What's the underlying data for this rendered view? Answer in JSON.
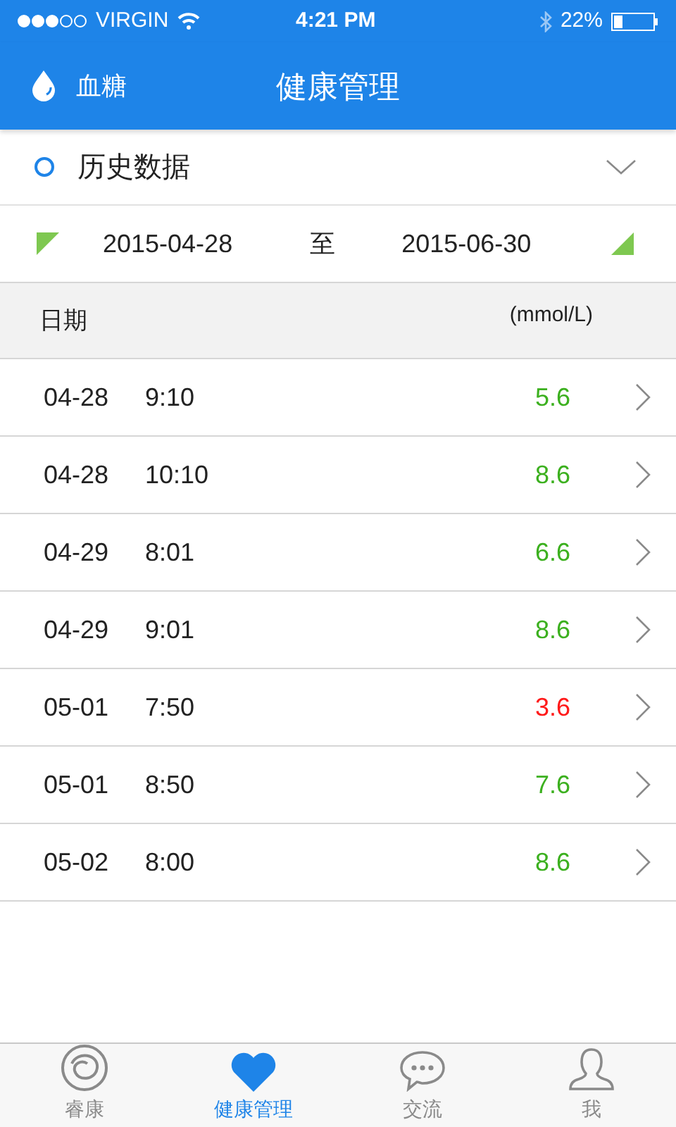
{
  "status_bar": {
    "carrier": "VIRGIN",
    "time": "4:21 PM",
    "battery": "22%"
  },
  "header": {
    "left_label": "血糖",
    "title": "健康管理"
  },
  "section": {
    "title": "历史数据",
    "expanded": false
  },
  "date_range": {
    "start": "2015-04-28",
    "separator": "至",
    "end": "2015-06-30"
  },
  "table": {
    "columns": [
      "日期",
      "(mmol/L)"
    ],
    "rows": [
      {
        "date": "04-28",
        "time": "9:10",
        "value": "5.6",
        "color": "#3cb01f"
      },
      {
        "date": "04-28",
        "time": "10:10",
        "value": "8.6",
        "color": "#3cb01f"
      },
      {
        "date": "04-29",
        "time": "8:01",
        "value": "6.6",
        "color": "#3cb01f"
      },
      {
        "date": "04-29",
        "time": "9:01",
        "value": "8.6",
        "color": "#3cb01f"
      },
      {
        "date": "05-01",
        "time": "7:50",
        "value": "3.6",
        "color": "#ff1a1a"
      },
      {
        "date": "05-01",
        "time": "8:50",
        "value": "7.6",
        "color": "#3cb01f"
      },
      {
        "date": "05-02",
        "time": "8:00",
        "value": "8.6",
        "color": "#3cb01f"
      }
    ]
  },
  "tab_bar": [
    {
      "kind": "swirl",
      "label": "睿康",
      "selected": false
    },
    {
      "kind": "heart",
      "label": "健康管理",
      "selected": true
    },
    {
      "kind": "chat",
      "label": "交流",
      "selected": false
    },
    {
      "kind": "person",
      "label": "我",
      "selected": false
    }
  ]
}
